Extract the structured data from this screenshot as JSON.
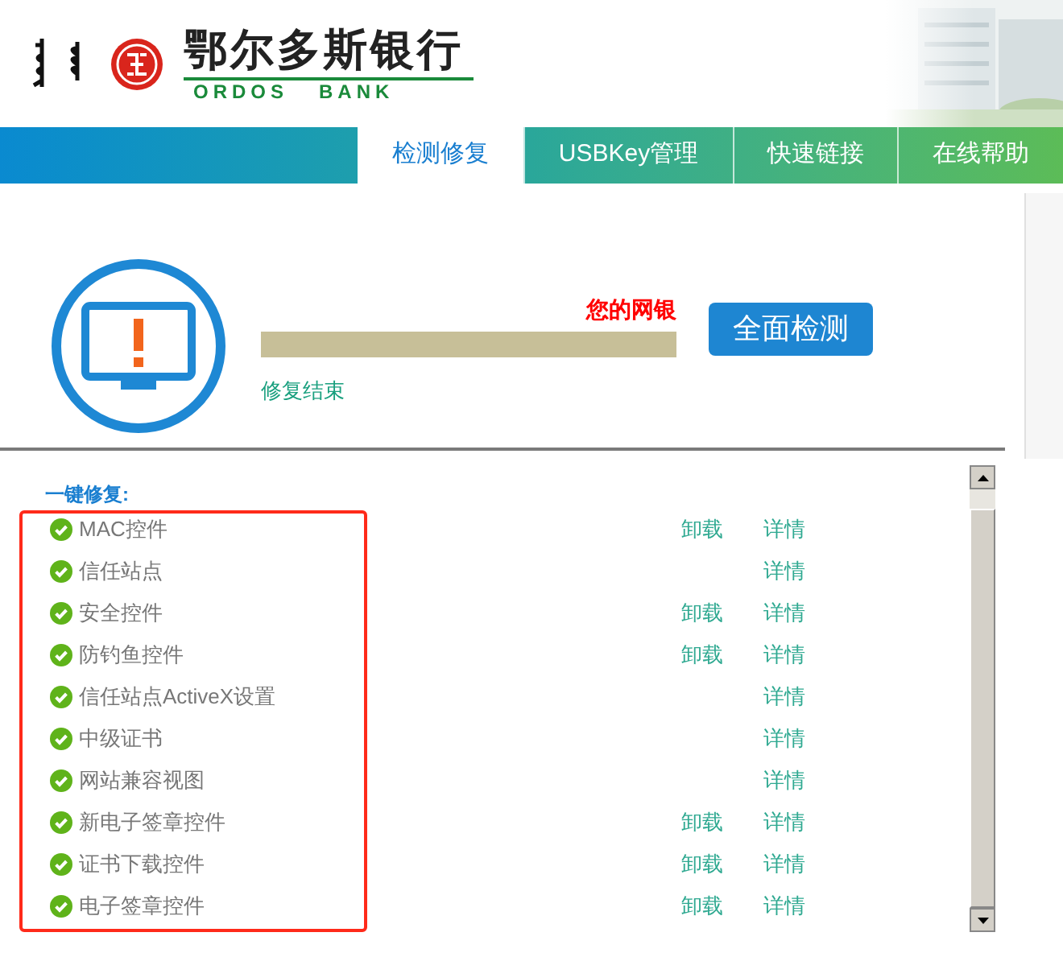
{
  "logo": {
    "name": "鄂尔多斯银行",
    "name_en": "ORDOS   BANK"
  },
  "tabs": [
    {
      "label": "检测修复",
      "selected": true
    },
    {
      "label": "USBKey管理",
      "selected": false
    },
    {
      "label": "快速链接",
      "selected": false
    },
    {
      "label": "在线帮助",
      "selected": false
    }
  ],
  "status": {
    "message": "您的网银",
    "level": 1,
    "result": "修复结束",
    "button": "全面检测"
  },
  "items": [
    {
      "kind": "heading",
      "name": "一键修复:"
    },
    {
      "kind": "ok",
      "name": "MAC控件",
      "uninstall": "卸载",
      "detail": "详情"
    },
    {
      "kind": "ok",
      "name": "信任站点",
      "detail": "详情"
    },
    {
      "kind": "ok",
      "name": "安全控件",
      "uninstall": "卸载",
      "detail": "详情"
    },
    {
      "kind": "ok",
      "name": "防钓鱼控件",
      "uninstall": "卸载",
      "detail": "详情"
    },
    {
      "kind": "ok",
      "name": "信任站点ActiveX设置",
      "detail": "详情"
    },
    {
      "kind": "ok",
      "name": "中级证书",
      "detail": "详情"
    },
    {
      "kind": "ok",
      "name": "网站兼容视图",
      "detail": "详情"
    },
    {
      "kind": "ok",
      "name": "新电子签章控件",
      "uninstall": "卸载",
      "detail": "详情"
    },
    {
      "kind": "ok",
      "name": "证书下载控件",
      "uninstall": "卸载",
      "detail": "详情"
    },
    {
      "kind": "ok",
      "name": "电子签章控件",
      "uninstall": "卸载",
      "detail": "详情"
    }
  ]
}
